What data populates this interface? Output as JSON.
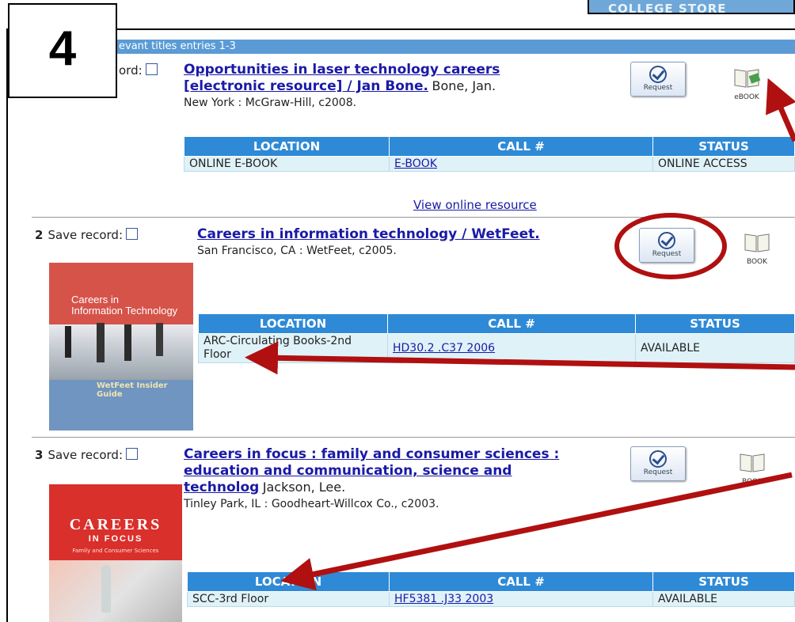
{
  "header": {
    "store_banner": "COLLEGE STORE",
    "results_text": "evant titles  entries 1-3",
    "step_number": "4"
  },
  "records": [
    {
      "number": "",
      "save_label": "ord:",
      "title": "Opportunities in laser technology careers [electronic resource] / Jan Bone.",
      "title_line1": "Opportunities in laser technology careers",
      "title_line2": "[electronic resource] / Jan Bone.",
      "author": "Bone, Jan.",
      "publication": "New York : McGraw-Hill, c2008.",
      "request_label": "Request",
      "format_label": "eBOOK",
      "table_headers": [
        "LOCATION",
        "CALL #",
        "STATUS"
      ],
      "location": "ONLINE E-BOOK",
      "call_number": "E-BOOK",
      "status": "ONLINE ACCESS",
      "online_link": "View online resource"
    },
    {
      "number": "2",
      "save_label": "Save record:",
      "title": "Careers in information technology / WetFeet.",
      "author": "",
      "publication": "San Francisco, CA : WetFeet, c2005.",
      "request_label": "Request",
      "format_label": "BOOK",
      "table_headers": [
        "LOCATION",
        "CALL #",
        "STATUS"
      ],
      "location": "ARC-Circulating Books-2nd Floor",
      "location_line1": "ARC-Circulating Books-2nd",
      "location_line2": "Floor",
      "call_number": "HD30.2 .C37 2006",
      "status": "AVAILABLE",
      "cover_title_1": "Careers in",
      "cover_title_2": "Information Technology",
      "cover_brand": "WetFeet Insider Guide"
    },
    {
      "number": "3",
      "save_label": "Save record:",
      "title_line1": "Careers in focus : family and consumer sciences :",
      "title_line2": "education and communication, science and",
      "title_line3": "technolog",
      "author": "Jackson, Lee.",
      "publication": "Tinley Park, IL : Goodheart-Willcox Co., c2003.",
      "request_label": "Request",
      "format_label": "BOOK",
      "table_headers": [
        "LOCATION",
        "CALL #",
        "STATUS"
      ],
      "location": "SCC-3rd Floor",
      "call_number": "HF5381 .J33 2003",
      "status": "AVAILABLE",
      "cover_title_1": "CAREERS",
      "cover_title_2": "IN FOCUS",
      "cover_subtitle": "Family and Consumer Sciences"
    }
  ],
  "colors": {
    "annotation": "#b01010",
    "link": "#1a1aa6",
    "table_header": "#2e8ad6",
    "table_row": "#dff2f8"
  }
}
